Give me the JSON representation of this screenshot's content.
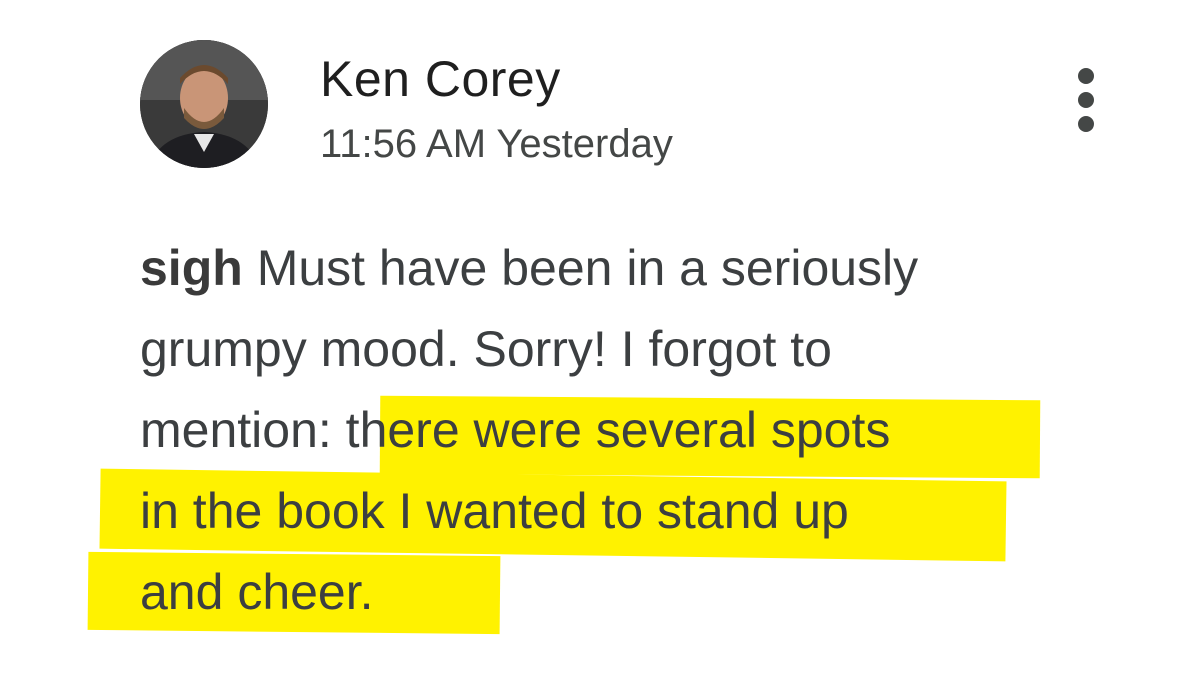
{
  "comment": {
    "author": "Ken Corey",
    "timestamp": "11:56 AM Yesterday",
    "more_icon": "more-vertical-icon",
    "body": {
      "emphasis": "sigh",
      "line1_rest": " Must have been in a seriously",
      "line2": "grumpy mood.  Sorry! I forgot to",
      "line3_plain": "mention: ",
      "line3_highlight": "there were several spots",
      "line4_highlight": "in the book I wanted to stand up",
      "line5_highlight": "and cheer."
    },
    "highlight_color": "#fff200"
  }
}
